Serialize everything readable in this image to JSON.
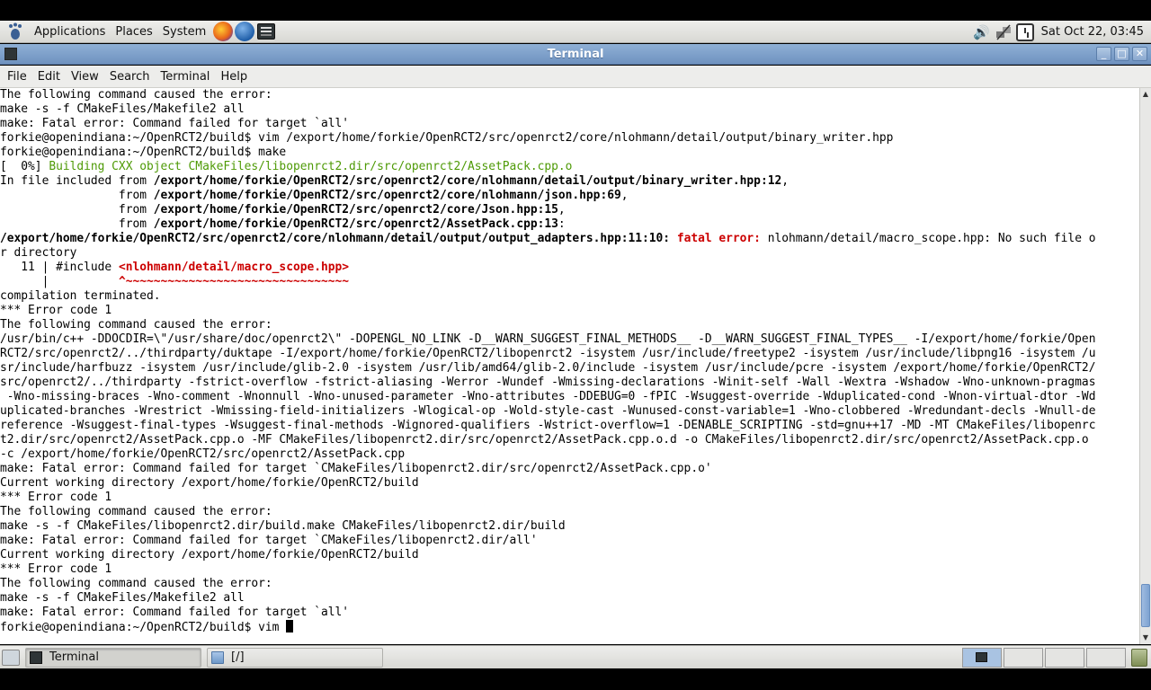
{
  "top_panel": {
    "menus": [
      "Applications",
      "Places",
      "System"
    ],
    "launchers": [
      "firefox-icon",
      "thunderbird-icon",
      "terminal-icon"
    ],
    "clock": "Sat Oct 22, 03:45"
  },
  "window": {
    "title": "Terminal",
    "menu": [
      "File",
      "Edit",
      "View",
      "Search",
      "Terminal",
      "Help"
    ]
  },
  "terminal_lines": [
    [
      {
        "t": "The following command caused the error:"
      }
    ],
    [
      {
        "t": "make -s -f CMakeFiles/Makefile2 all"
      }
    ],
    [
      {
        "t": "make: Fatal error: Command failed for target `all'"
      }
    ],
    [
      {
        "t": "forkie@openindiana:~/OpenRCT2/build$ vim /export/home/forkie/OpenRCT2/src/openrct2/core/nlohmann/detail/output/binary_writer.hpp"
      }
    ],
    [
      {
        "t": "forkie@openindiana:~/OpenRCT2/build$ make"
      }
    ],
    [
      {
        "t": "[  0%] "
      },
      {
        "t": "Building CXX object CMakeFiles/libopenrct2.dir/src/openrct2/AssetPack.cpp.o",
        "c": "green"
      }
    ],
    [
      {
        "t": "In file included from "
      },
      {
        "t": "/export/home/forkie/OpenRCT2/src/openrct2/core/nlohmann/detail/output/binary_writer.hpp:12",
        "c": "bold"
      },
      {
        "t": ","
      }
    ],
    [
      {
        "t": "                 from "
      },
      {
        "t": "/export/home/forkie/OpenRCT2/src/openrct2/core/nlohmann/json.hpp:69",
        "c": "bold"
      },
      {
        "t": ","
      }
    ],
    [
      {
        "t": "                 from "
      },
      {
        "t": "/export/home/forkie/OpenRCT2/src/openrct2/core/Json.hpp:15",
        "c": "bold"
      },
      {
        "t": ","
      }
    ],
    [
      {
        "t": "                 from "
      },
      {
        "t": "/export/home/forkie/OpenRCT2/src/openrct2/AssetPack.cpp:13",
        "c": "bold"
      },
      {
        "t": ":"
      }
    ],
    [
      {
        "t": "/export/home/forkie/OpenRCT2/src/openrct2/core/nlohmann/detail/output/output_adapters.hpp:11:10:",
        "c": "bold"
      },
      {
        "t": " "
      },
      {
        "t": "fatal error:",
        "c": "red"
      },
      {
        "t": " nlohmann/detail/macro_scope.hpp: No such file o"
      }
    ],
    [
      {
        "t": "r directory"
      }
    ],
    [
      {
        "t": "   11 | #include "
      },
      {
        "t": "<nlohmann/detail/macro_scope.hpp>",
        "c": "red"
      }
    ],
    [
      {
        "t": "      |          "
      },
      {
        "t": "^~~~~~~~~~~~~~~~~~~~~~~~~~~~~~~~~",
        "c": "red"
      }
    ],
    [
      {
        "t": "compilation terminated."
      }
    ],
    [
      {
        "t": "*** Error code 1"
      }
    ],
    [
      {
        "t": "The following command caused the error:"
      }
    ],
    [
      {
        "t": "/usr/bin/c++ -DDOCDIR=\\\"/usr/share/doc/openrct2\\\" -DOPENGL_NO_LINK -D__WARN_SUGGEST_FINAL_METHODS__ -D__WARN_SUGGEST_FINAL_TYPES__ -I/export/home/forkie/Open"
      }
    ],
    [
      {
        "t": "RCT2/src/openrct2/../thirdparty/duktape -I/export/home/forkie/OpenRCT2/libopenrct2 -isystem /usr/include/freetype2 -isystem /usr/include/libpng16 -isystem /u"
      }
    ],
    [
      {
        "t": "sr/include/harfbuzz -isystem /usr/include/glib-2.0 -isystem /usr/lib/amd64/glib-2.0/include -isystem /usr/include/pcre -isystem /export/home/forkie/OpenRCT2/"
      }
    ],
    [
      {
        "t": "src/openrct2/../thirdparty -fstrict-overflow -fstrict-aliasing -Werror -Wundef -Wmissing-declarations -Winit-self -Wall -Wextra -Wshadow -Wno-unknown-pragmas"
      }
    ],
    [
      {
        "t": " -Wno-missing-braces -Wno-comment -Wnonnull -Wno-unused-parameter -Wno-attributes -DDEBUG=0 -fPIC -Wsuggest-override -Wduplicated-cond -Wnon-virtual-dtor -Wd"
      }
    ],
    [
      {
        "t": "uplicated-branches -Wrestrict -Wmissing-field-initializers -Wlogical-op -Wold-style-cast -Wunused-const-variable=1 -Wno-clobbered -Wredundant-decls -Wnull-de"
      }
    ],
    [
      {
        "t": "reference -Wsuggest-final-types -Wsuggest-final-methods -Wignored-qualifiers -Wstrict-overflow=1 -DENABLE_SCRIPTING -std=gnu++17 -MD -MT CMakeFiles/libopenrc"
      }
    ],
    [
      {
        "t": "t2.dir/src/openrct2/AssetPack.cpp.o -MF CMakeFiles/libopenrct2.dir/src/openrct2/AssetPack.cpp.o.d -o CMakeFiles/libopenrct2.dir/src/openrct2/AssetPack.cpp.o"
      }
    ],
    [
      {
        "t": "-c /export/home/forkie/OpenRCT2/src/openrct2/AssetPack.cpp"
      }
    ],
    [
      {
        "t": "make: Fatal error: Command failed for target `CMakeFiles/libopenrct2.dir/src/openrct2/AssetPack.cpp.o'"
      }
    ],
    [
      {
        "t": "Current working directory /export/home/forkie/OpenRCT2/build"
      }
    ],
    [
      {
        "t": "*** Error code 1"
      }
    ],
    [
      {
        "t": "The following command caused the error:"
      }
    ],
    [
      {
        "t": "make -s -f CMakeFiles/libopenrct2.dir/build.make CMakeFiles/libopenrct2.dir/build"
      }
    ],
    [
      {
        "t": "make: Fatal error: Command failed for target `CMakeFiles/libopenrct2.dir/all'"
      }
    ],
    [
      {
        "t": "Current working directory /export/home/forkie/OpenRCT2/build"
      }
    ],
    [
      {
        "t": "*** Error code 1"
      }
    ],
    [
      {
        "t": "The following command caused the error:"
      }
    ],
    [
      {
        "t": "make -s -f CMakeFiles/Makefile2 all"
      }
    ],
    [
      {
        "t": "make: Fatal error: Command failed for target `all'"
      }
    ],
    [
      {
        "t": "forkie@openindiana:~/OpenRCT2/build$ vim "
      }
    ]
  ],
  "bottom_panel": {
    "tasks": [
      "Terminal",
      "[/]"
    ]
  }
}
